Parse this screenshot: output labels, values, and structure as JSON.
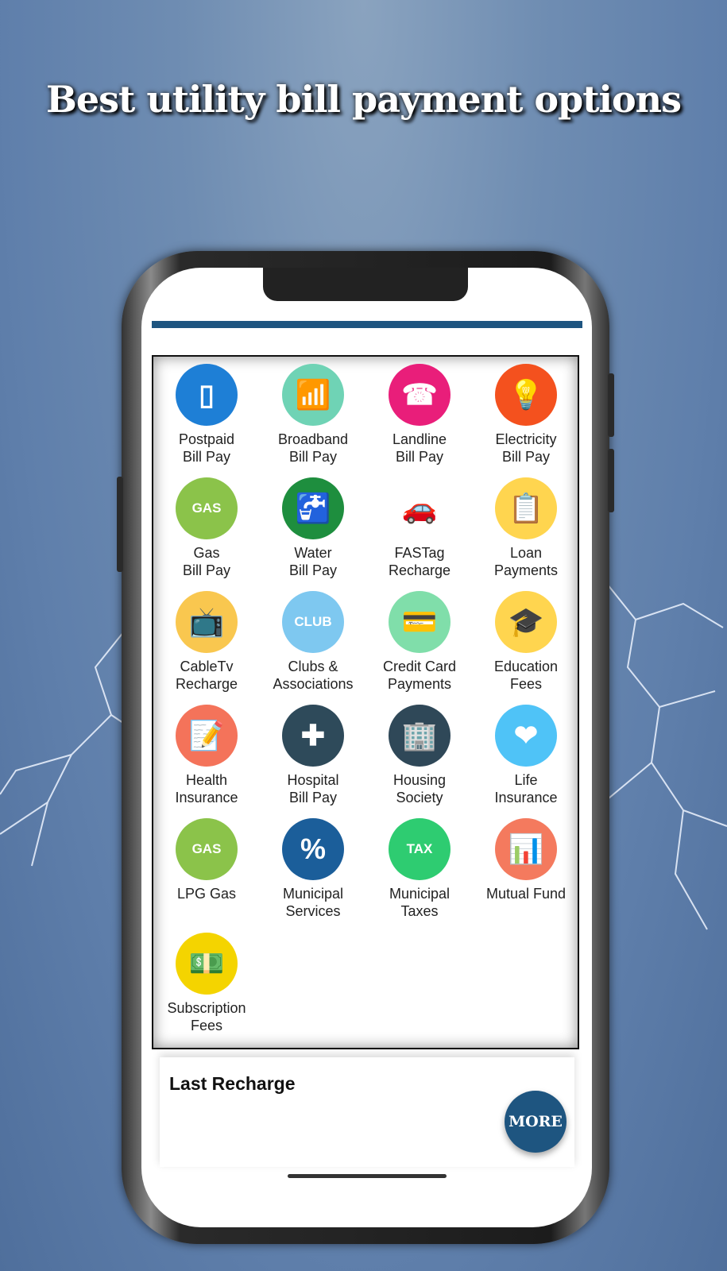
{
  "headline": "Best utility bill payment options",
  "services": [
    {
      "label1": "Postpaid",
      "label2": "Bill Pay",
      "icon": "mobile-phone-icon",
      "color": "#1e7fd6",
      "glyph": "▯"
    },
    {
      "label1": "Broadband",
      "label2": "Bill Pay",
      "icon": "router-icon",
      "color": "#6fd3b5",
      "glyph": "📶"
    },
    {
      "label1": "Landline",
      "label2": "Bill Pay",
      "icon": "telephone-icon",
      "color": "#e91e7a",
      "glyph": "☎"
    },
    {
      "label1": "Electricity",
      "label2": "Bill Pay",
      "icon": "light-bulb-icon",
      "color": "#f4511e",
      "glyph": "💡"
    },
    {
      "label1": "Gas",
      "label2": "Bill Pay",
      "icon": "gas-cylinder-icon",
      "color": "#8bc34a",
      "glyph": "GAS"
    },
    {
      "label1": "Water",
      "label2": "Bill Pay",
      "icon": "water-tap-icon",
      "color": "#1e8e3e",
      "glyph": "🚰"
    },
    {
      "label1": "FASTag",
      "label2": "Recharge",
      "icon": "toll-gate-icon",
      "color": "#ffffff",
      "glyph": "🚗"
    },
    {
      "label1": "Loan",
      "label2": "Payments",
      "icon": "loan-document-icon",
      "color": "#ffd54f",
      "glyph": "📋"
    },
    {
      "label1": "CableTv",
      "label2": "Recharge",
      "icon": "television-icon",
      "color": "#f9c74f",
      "glyph": "📺"
    },
    {
      "label1": "Clubs &",
      "label2": "Associations",
      "icon": "club-icon",
      "color": "#7ec8f0",
      "glyph": "CLUB"
    },
    {
      "label1": "Credit Card",
      "label2": "Payments",
      "icon": "credit-card-icon",
      "color": "#80deaa",
      "glyph": "💳"
    },
    {
      "label1": "Education",
      "label2": "Fees",
      "icon": "graduation-cap-icon",
      "color": "#ffd54f",
      "glyph": "🎓"
    },
    {
      "label1": "Health",
      "label2": "Insurance",
      "icon": "health-form-icon",
      "color": "#f4735a",
      "glyph": "📝"
    },
    {
      "label1": "Hospital",
      "label2": "Bill Pay",
      "icon": "first-aid-kit-icon",
      "color": "#2e4a5a",
      "glyph": "✚"
    },
    {
      "label1": "Housing",
      "label2": "Society",
      "icon": "building-icon",
      "color": "#2f4858",
      "glyph": "🏢"
    },
    {
      "label1": "Life",
      "label2": "Insurance",
      "icon": "heart-hands-icon",
      "color": "#4fc3f7",
      "glyph": "❤"
    },
    {
      "label1": "LPG Gas",
      "label2": "",
      "icon": "gas-cylinder-icon",
      "color": "#8bc34a",
      "glyph": "GAS"
    },
    {
      "label1": "Municipal",
      "label2": "Services",
      "icon": "municipal-services-icon",
      "color": "#1b5e9a",
      "glyph": "%"
    },
    {
      "label1": "Municipal",
      "label2": "Taxes",
      "icon": "tax-icon",
      "color": "#2ecc71",
      "glyph": "TAX"
    },
    {
      "label1": "Mutual Fund",
      "label2": "",
      "icon": "growth-chart-icon",
      "color": "#f47a5e",
      "glyph": "📊"
    },
    {
      "label1": "Subscription",
      "label2": "Fees",
      "icon": "cash-icon",
      "color": "#f4d400",
      "glyph": "💵"
    }
  ],
  "last_recharge": {
    "title": "Last Recharge",
    "more_label": "MORE"
  },
  "accent": "#1e5580"
}
